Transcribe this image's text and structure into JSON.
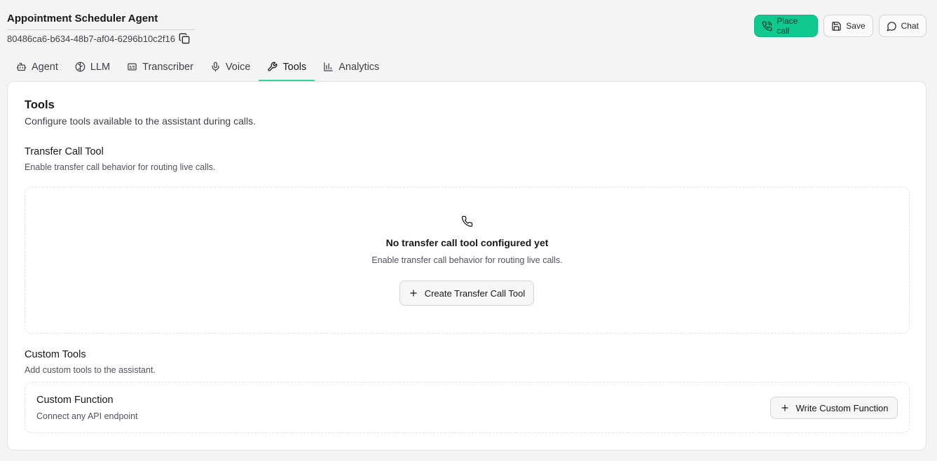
{
  "header": {
    "title": "Appointment Scheduler Agent",
    "agent_id": "80486ca6-b634-48b7-af04-6296b10c2f16"
  },
  "actions": {
    "place_call": "Place call",
    "save": "Save",
    "chat": "Chat"
  },
  "tabs": [
    {
      "label": "Agent",
      "icon": "robot-icon"
    },
    {
      "label": "LLM",
      "icon": "brain-icon"
    },
    {
      "label": "Transcriber",
      "icon": "captions-icon"
    },
    {
      "label": "Voice",
      "icon": "mic-icon"
    },
    {
      "label": "Tools",
      "icon": "wrench-icon",
      "active": true
    },
    {
      "label": "Analytics",
      "icon": "bar-chart-icon"
    }
  ],
  "tools": {
    "title": "Tools",
    "subtitle": "Configure tools available to the assistant during calls.",
    "transfer": {
      "heading": "Transfer Call Tool",
      "description": "Enable transfer call behavior for routing live calls.",
      "empty_title": "No transfer call tool configured yet",
      "empty_description": "Enable transfer call behavior for routing live calls.",
      "create_label": "Create Transfer Call Tool"
    },
    "custom": {
      "heading": "Custom Tools",
      "description": "Add custom tools to the assistant.",
      "function_title": "Custom Function",
      "function_description": "Connect any API endpoint",
      "write_label": "Write Custom Function"
    }
  },
  "colors": {
    "accent": "#10c98f",
    "tab_underline": "#3fcf9a",
    "background": "#f4f4f5",
    "card": "#ffffff"
  }
}
